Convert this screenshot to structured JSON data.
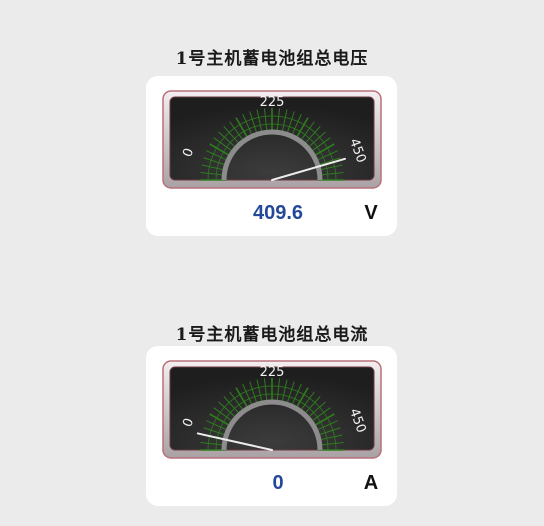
{
  "gauges": [
    {
      "title": "1号主机蓄电池组总电压",
      "value": 409.6,
      "value_text": "409.6",
      "unit": "V",
      "min": 0,
      "max": 450,
      "min_label": "0",
      "mid_label": "225",
      "max_label": "450"
    },
    {
      "title": "1号主机蓄电池组总电流",
      "value": 0,
      "value_text": "0",
      "unit": "A",
      "min": 0,
      "max": 450,
      "min_label": "0",
      "mid_label": "225",
      "max_label": "450"
    }
  ],
  "colors": {
    "page_background": "#ebebeb",
    "card_background": "#ffffff",
    "gauge_face": "#1e1e1e",
    "tick_color": "#2e7d1e",
    "needle_color": "#ececec",
    "value_color": "#24489a",
    "bezel_border": "#b8707a"
  }
}
